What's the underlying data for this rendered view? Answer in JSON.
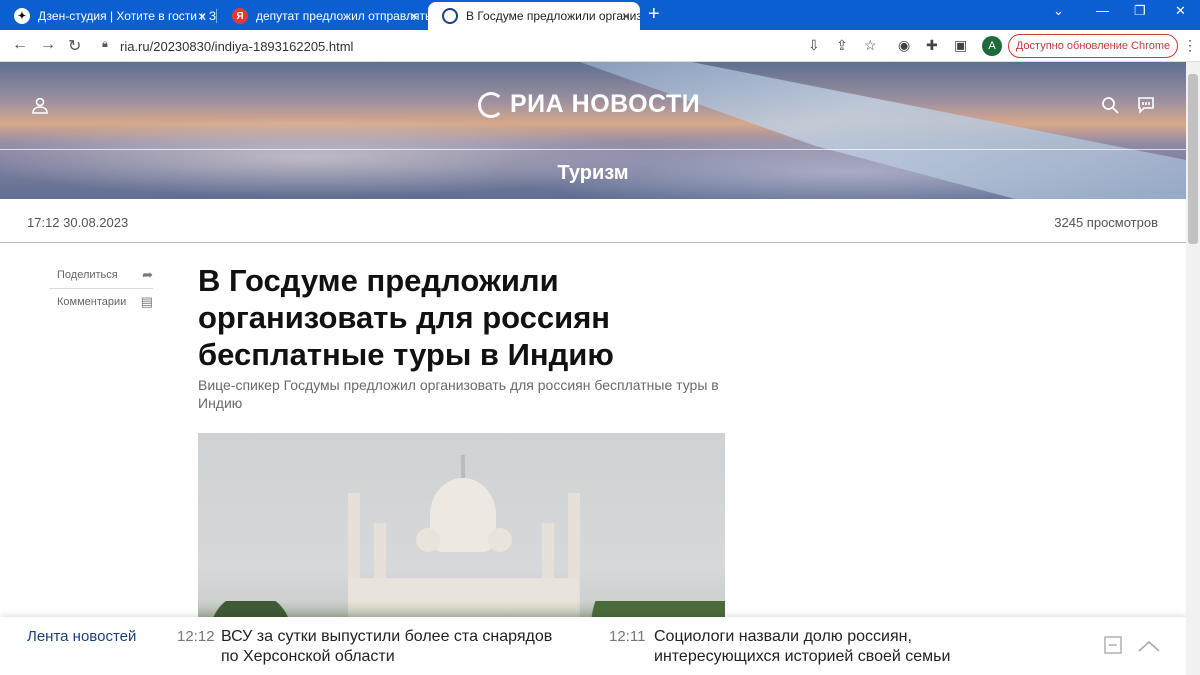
{
  "tabs": [
    {
      "title": "Дзен-студия | Хотите в гости к З",
      "icon": "zen-icon",
      "close": "×"
    },
    {
      "title": "депутат предложил отправлять",
      "icon": "yandex-icon",
      "icon_glyph": "Я",
      "close": "×"
    },
    {
      "title": "В Госдуме предложили организ",
      "icon": "ria-icon",
      "close": "×",
      "active": true
    }
  ],
  "new_tab": "+",
  "window_controls": {
    "dropdown": "⌄",
    "minimize": "—",
    "maximize": "❐",
    "close": "✕"
  },
  "toolbar": {
    "back": "←",
    "forward": "→",
    "reload": "↻",
    "url": "ria.ru/20230830/indiya-1893162205.html",
    "avatar_letter": "A",
    "update_button": "Доступно обновление Chrome",
    "menu": "⋮"
  },
  "site": {
    "logo_text": "РИА НОВОСТИ",
    "section": "Туризм"
  },
  "article": {
    "date": "17:12 30.08.2023",
    "views": "3245 просмотров",
    "share_label": "Поделиться",
    "comments_label": "Комментарии",
    "headline": "В Госдуме предложили организовать для россиян бесплатные туры в Индию",
    "lead": "Вице-спикер Госдумы предложил организовать для россиян бесплатные туры в Индию"
  },
  "news_feed": {
    "label": "Лента новостей",
    "items": [
      {
        "time": "12:12",
        "text": "ВСУ за сутки выпустили более ста снарядов по Херсонской области"
      },
      {
        "time": "12:11",
        "text": "Социологи назвали долю россиян, интересующихся историей своей семьи"
      }
    ]
  },
  "colors": {
    "chrome_tabbar": "#0b5fd1",
    "update_accent": "#c93a3a",
    "news_label": "#1d3f7a"
  }
}
